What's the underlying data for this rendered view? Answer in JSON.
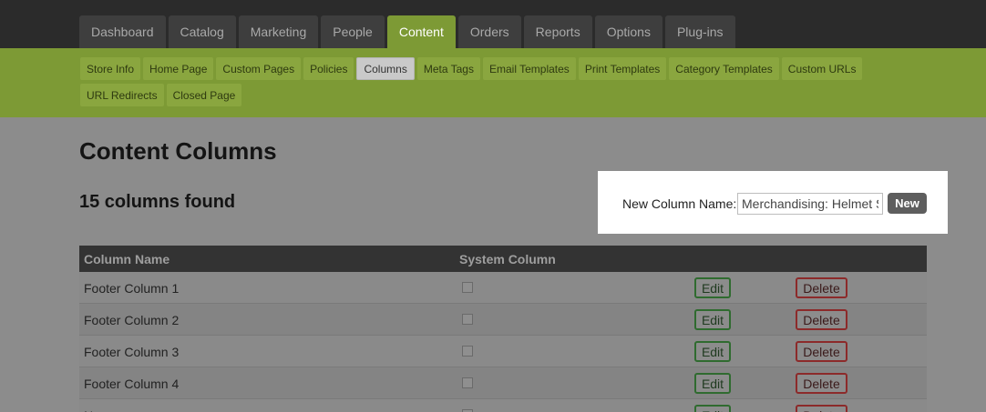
{
  "top_nav": [
    "Dashboard",
    "Catalog",
    "Marketing",
    "People",
    "Content",
    "Orders",
    "Reports",
    "Options",
    "Plug-ins"
  ],
  "top_nav_active": "Content",
  "sub_nav": [
    "Store Info",
    "Home Page",
    "Custom Pages",
    "Policies",
    "Columns",
    "Meta Tags",
    "Email Templates",
    "Print Templates",
    "Category Templates",
    "Custom URLs",
    "URL Redirects",
    "Closed Page"
  ],
  "sub_nav_active": "Columns",
  "page": {
    "title": "Content Columns",
    "count_text": "15 columns found"
  },
  "new_column": {
    "label": "New Column Name:",
    "value": "Merchandising: Helmet S",
    "button": "New"
  },
  "table": {
    "headers": [
      "Column Name",
      "System Column"
    ],
    "edit_label": "Edit",
    "delete_label": "Delete",
    "rows": [
      "Footer Column 1",
      "Footer Column 2",
      "Footer Column 3",
      "Footer Column 4",
      "N"
    ]
  },
  "colors": {
    "topbar": "#2b2b2b",
    "accent_green": "#7d9a35",
    "overlay_gray": "#8c8c8c"
  }
}
